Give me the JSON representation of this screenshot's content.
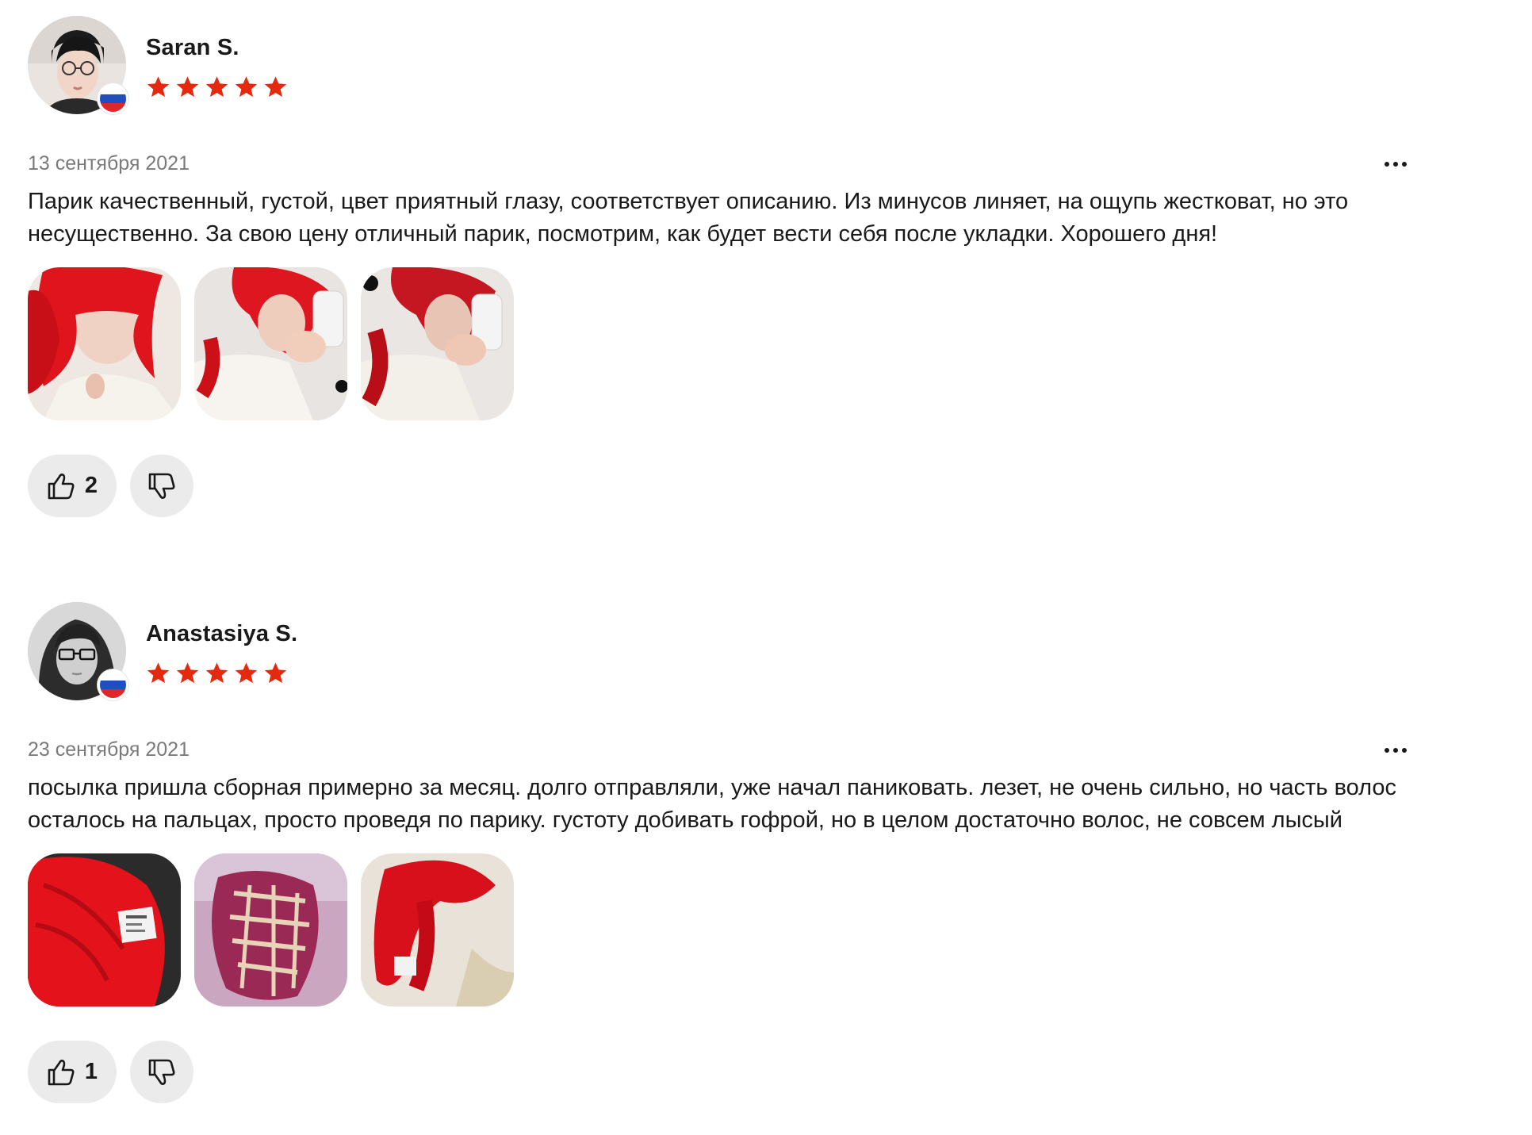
{
  "reviews": [
    {
      "name": "Saran S.",
      "rating": 5,
      "country_flag": "ru-flag",
      "date": "13 сентября 2021",
      "text": "Парик качественный, густой, цвет приятный глазу, соответствует описанию. Из минусов линяет, на ощупь жестковат, но это несущественно. За свою цену отличный парик, посмотрим, как будет вести себя после укладки. Хорошего дня!",
      "photo_count": 3,
      "likes": "2"
    },
    {
      "name": "Anastasiya S.",
      "rating": 5,
      "country_flag": "ru-flag",
      "date": "23 сентября 2021",
      "text": "посылка пришла сборная примерно за месяц. долго отправляли, уже начал паниковать. лезет, не очень сильно, но часть волос осталось на пальцах, просто проведя по парику. густоту добивать гофрой, но в целом достаточно волос, не совсем лысый",
      "photo_count": 3,
      "likes": "1"
    }
  ],
  "colors": {
    "star": "#e4290e",
    "vote_bg": "#ebebeb",
    "date": "#7a7a7a",
    "wig_red": "#e0141c"
  },
  "icons": [
    "star-icon",
    "thumbs-up-icon",
    "thumbs-down-icon",
    "more-options-icon",
    "ru-flag-icon"
  ]
}
